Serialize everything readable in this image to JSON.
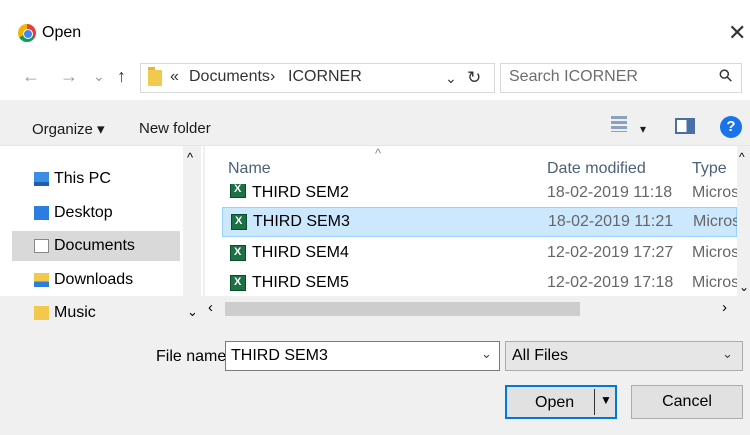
{
  "window": {
    "title": "Open",
    "close_glyph": "✕"
  },
  "nav": {
    "back_glyph": "←",
    "forward_glyph": "→",
    "recent_glyph": "⌄",
    "up_glyph": "↑",
    "breadcrumb_sep_root": "«",
    "breadcrumbs": [
      "Documents",
      "ICORNER"
    ],
    "breadcrumb_sep": "›",
    "addr_dropdown_glyph": "⌄",
    "refresh_glyph": "↻",
    "search_placeholder": "Search ICORNER",
    "search_glyph": "⚲"
  },
  "toolbar": {
    "organize_label": "Organize ▾",
    "new_folder_label": "New folder",
    "view_arrow": "▾",
    "help_label": "?"
  },
  "sidebar": {
    "items": [
      {
        "label": "This PC",
        "icon": "pc-icon"
      },
      {
        "label": "Desktop",
        "icon": "desktop-icon"
      },
      {
        "label": "Documents",
        "icon": "documents-icon",
        "selected": true
      },
      {
        "label": "Downloads",
        "icon": "downloads-icon"
      },
      {
        "label": "Music",
        "icon": "music-icon"
      }
    ],
    "scroll_up_glyph": "^",
    "scroll_down_glyph": "⌄"
  },
  "file_list": {
    "columns": {
      "name": "Name",
      "date": "Date modified",
      "type": "Type",
      "sort_glyph": "^"
    },
    "rows": [
      {
        "name": "THIRD SEM2",
        "date": "18-02-2019 11:18",
        "type": "Micros"
      },
      {
        "name": "THIRD SEM3",
        "date": "18-02-2019 11:21",
        "type": "Micros",
        "selected": true
      },
      {
        "name": "THIRD SEM4",
        "date": "12-02-2019 17:27",
        "type": "Micros"
      },
      {
        "name": "THIRD SEM5",
        "date": "12-02-2019 17:18",
        "type": "Micros"
      }
    ],
    "scroll_left_glyph": "‹",
    "scroll_right_glyph": "›",
    "scroll_up_glyph": "^",
    "scroll_down_glyph": "⌄"
  },
  "footer": {
    "file_name_label": "File name:",
    "file_name_value": "THIRD SEM3",
    "file_name_arrow": "⌄",
    "file_type_value": "All Files",
    "file_type_arrow": "⌄",
    "open_label": "Open",
    "open_arrow": "▼",
    "cancel_label": "Cancel"
  },
  "colors": {
    "accent": "#0078d7",
    "selection": "#cce8ff",
    "help": "#1a73e8"
  }
}
